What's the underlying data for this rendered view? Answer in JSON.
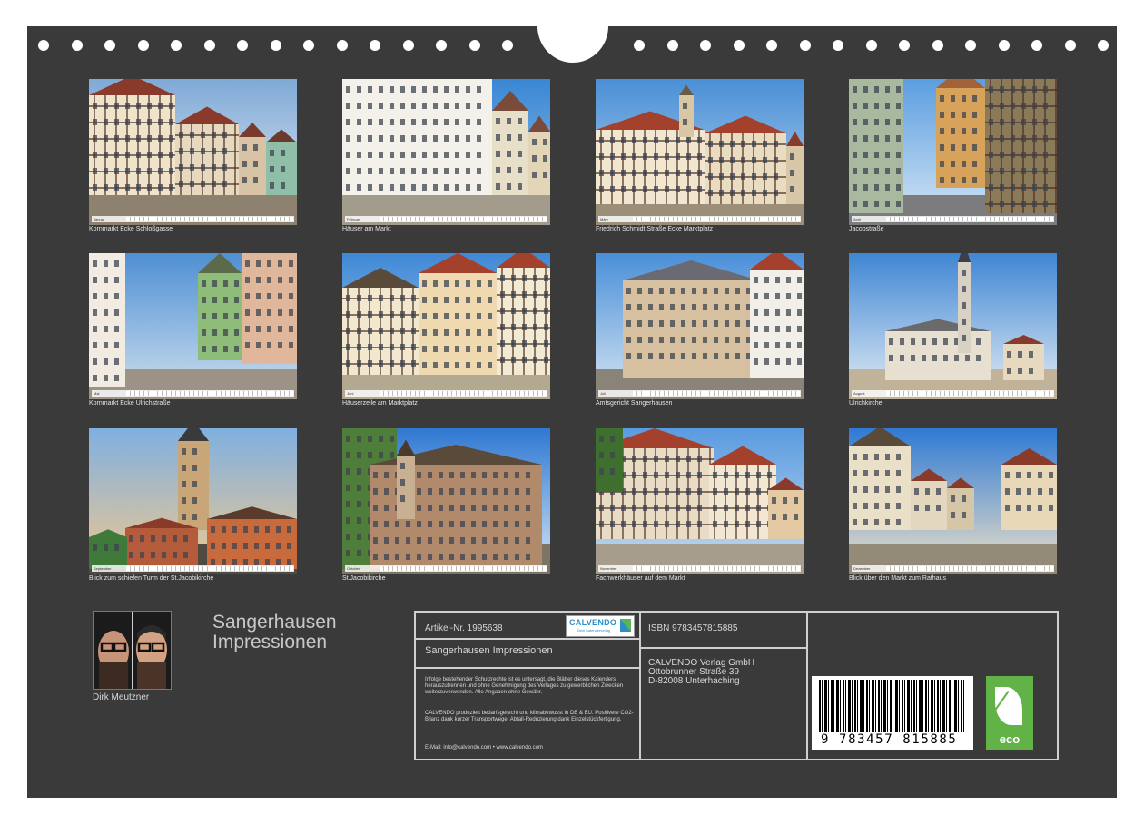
{
  "calendar": {
    "photos": [
      {
        "caption": "Kornmarkt Ecke Schloßgasse",
        "month": "Januar"
      },
      {
        "caption": "Häuser am Markt",
        "month": "Februar"
      },
      {
        "caption": "Friedrich Schmidt Straße Ecke Marktplatz",
        "month": "März"
      },
      {
        "caption": "Jacobstraße",
        "month": "April"
      },
      {
        "caption": "Kornmarkt Ecke Ulrichstraße",
        "month": "Mai"
      },
      {
        "caption": "Häuserzeile am Marktplatz",
        "month": "Juni"
      },
      {
        "caption": "Amtsgericht Sangerhausen",
        "month": "Juli"
      },
      {
        "caption": "Ulrichkirche",
        "month": "August"
      },
      {
        "caption": "Blick zum schiefen Turm der St.Jacobikirche",
        "month": "September"
      },
      {
        "caption": "St.Jacobikirche",
        "month": "Oktober"
      },
      {
        "caption": "Fachwerkhäuser auf dem Markt",
        "month": "November"
      },
      {
        "caption": "Blick über den Markt  zum Rathaus",
        "month": "Dezember"
      }
    ]
  },
  "author": {
    "name": "Dirk Meutzner"
  },
  "title": {
    "line1": "Sangerhausen",
    "line2": "Impressionen"
  },
  "info": {
    "article": "Artikel-Nr. 1995638",
    "product_title": "Sangerhausen Impressionen",
    "logo_word": "CALVENDO",
    "logo_tagline": "Dein Kalenderverlag",
    "legal_1": "Infolge bestehender Schutzrechte ist es untersagt, die Blätter dieses Kalenders herauszutrennen und ohne Genehmigung des Verlages zu gewerblichen Zwecken weiterzuverwenden. Alle Angaben ohne Gewähr.",
    "legal_2": "CALVENDO produziert bedarfsgerecht und klimabewusst in DE & EU. Positivere CO2-Bilanz dank kurzer Transportwege. Abfall-Reduzierung dank Einzelstückfertigung.",
    "contact": "E-Mail: info@calvendo.com • www.calvendo.com",
    "isbn": "ISBN 9783457815885",
    "publisher": "CALVENDO Verlag GmbH",
    "street": "Ottobrunner Straße 39",
    "city": "D-82008 Unterhaching",
    "barcode_number": "9 783457 815885",
    "eco_label": "eco"
  }
}
